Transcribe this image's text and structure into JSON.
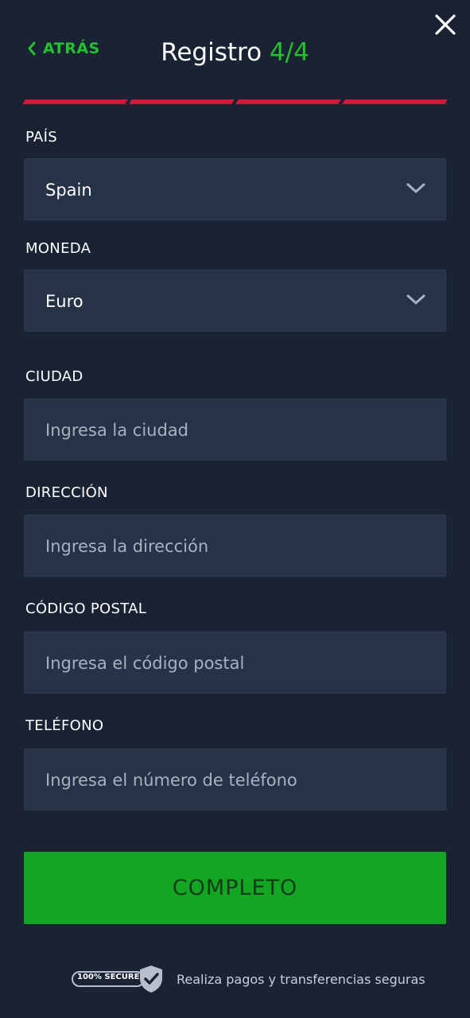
{
  "header": {
    "back_label": "ATRÁS",
    "title": "Registro",
    "step": "4/4",
    "progress_segments": 4,
    "progress_completed": 4
  },
  "form": {
    "country": {
      "label": "PAÍS",
      "value": "Spain"
    },
    "currency": {
      "label": "MONEDA",
      "value": "Euro"
    },
    "city": {
      "label": "CIUDAD",
      "placeholder": "Ingresa la ciudad"
    },
    "address": {
      "label": "DIRECCIÓN",
      "placeholder": "Ingresa la dirección"
    },
    "postal_code": {
      "label": "CÓDIGO POSTAL",
      "placeholder": "Ingresa el código postal"
    },
    "phone": {
      "label": "TELÉFONO",
      "placeholder": "Ingresa el número de teléfono"
    }
  },
  "submit": {
    "label": "COMPLETO"
  },
  "footer": {
    "badge_text": "100% SECURE",
    "text": "Realiza pagos y transferencias seguras"
  },
  "colors": {
    "background": "#1a2333",
    "field": "#263245",
    "accent_green": "#24c12f",
    "button_green": "#12a622",
    "progress_red": "#d4173a"
  },
  "icons": {
    "back": "chevron-left-icon",
    "close": "close-icon",
    "dropdown": "chevron-down-icon",
    "secure": "shield-check-icon"
  }
}
